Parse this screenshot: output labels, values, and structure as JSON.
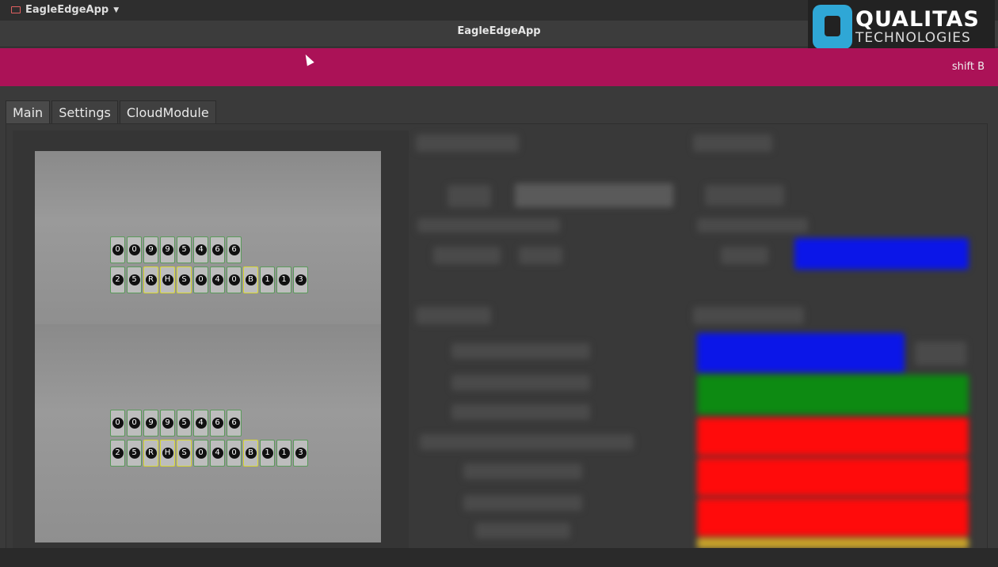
{
  "system": {
    "app_menu_label": "EagleEdgeApp"
  },
  "window": {
    "title": "EagleEdgeApp"
  },
  "logo": {
    "line1": "QUALITAS",
    "line2": "TECHNOLOGIES"
  },
  "banner": {
    "shift_label": "shift B",
    "color": "#ab1257"
  },
  "tabs": [
    {
      "label": "Main"
    },
    {
      "label": "Settings"
    },
    {
      "label": "CloudModule"
    }
  ],
  "images": [
    {
      "row1": [
        "0",
        "0",
        "9",
        "9",
        "5",
        "4",
        "6",
        "6"
      ],
      "row2": [
        "2",
        "5",
        "R",
        "H",
        "S",
        "0",
        "4",
        "0",
        "B",
        "1",
        "1",
        "3"
      ]
    },
    {
      "row1": [
        "0",
        "0",
        "9",
        "9",
        "5",
        "4",
        "6",
        "6"
      ],
      "row2": [
        "2",
        "5",
        "R",
        "H",
        "S",
        "0",
        "4",
        "0",
        "B",
        "1",
        "1",
        "3"
      ]
    }
  ],
  "status_colors": {
    "blue": "#0b16e8",
    "green": "#0d8a12",
    "red": "#ff0b0b",
    "orange": "#c9a32a"
  }
}
